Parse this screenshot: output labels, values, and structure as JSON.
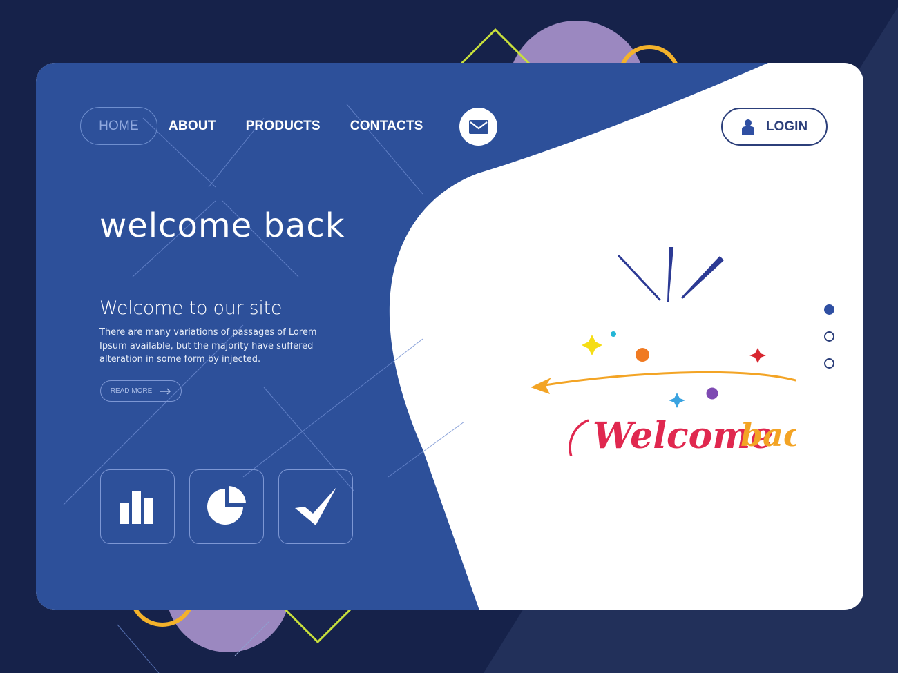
{
  "nav": {
    "items": [
      {
        "label": "HOME",
        "active": true
      },
      {
        "label": "ABOUT",
        "active": false
      },
      {
        "label": "PRODUCTS",
        "active": false
      },
      {
        "label": "CONTACTS",
        "active": false
      }
    ],
    "mail_icon": "envelope-icon",
    "login_label": "LOGIN",
    "login_icon": "user-icon"
  },
  "hero": {
    "title": "welcome back",
    "subtitle": "Welcome to our site",
    "body": "There are many variations of passages of Lorem Ipsum available, but the majority have suffered alteration in some form by injected.",
    "read_more_label": "READ MORE",
    "read_more_icon": "arrow-right-icon"
  },
  "features": [
    {
      "icon": "bar-chart-icon"
    },
    {
      "icon": "pie-chart-icon"
    },
    {
      "icon": "checkmark-icon"
    }
  ],
  "illustration": {
    "word1": "Welcome",
    "word2": "back"
  },
  "pagination": {
    "count": 3,
    "active_index": 0
  },
  "colors": {
    "page_bg": "#16224a",
    "card_blue": "#2d509a",
    "card_white": "#ffffff",
    "login_navy": "#2c3f7a",
    "lavender": "#9b88c0",
    "lime": "#c8e03c",
    "gold": "#f3b22b",
    "script_red": "#e0284f",
    "script_orange": "#f3a425"
  }
}
